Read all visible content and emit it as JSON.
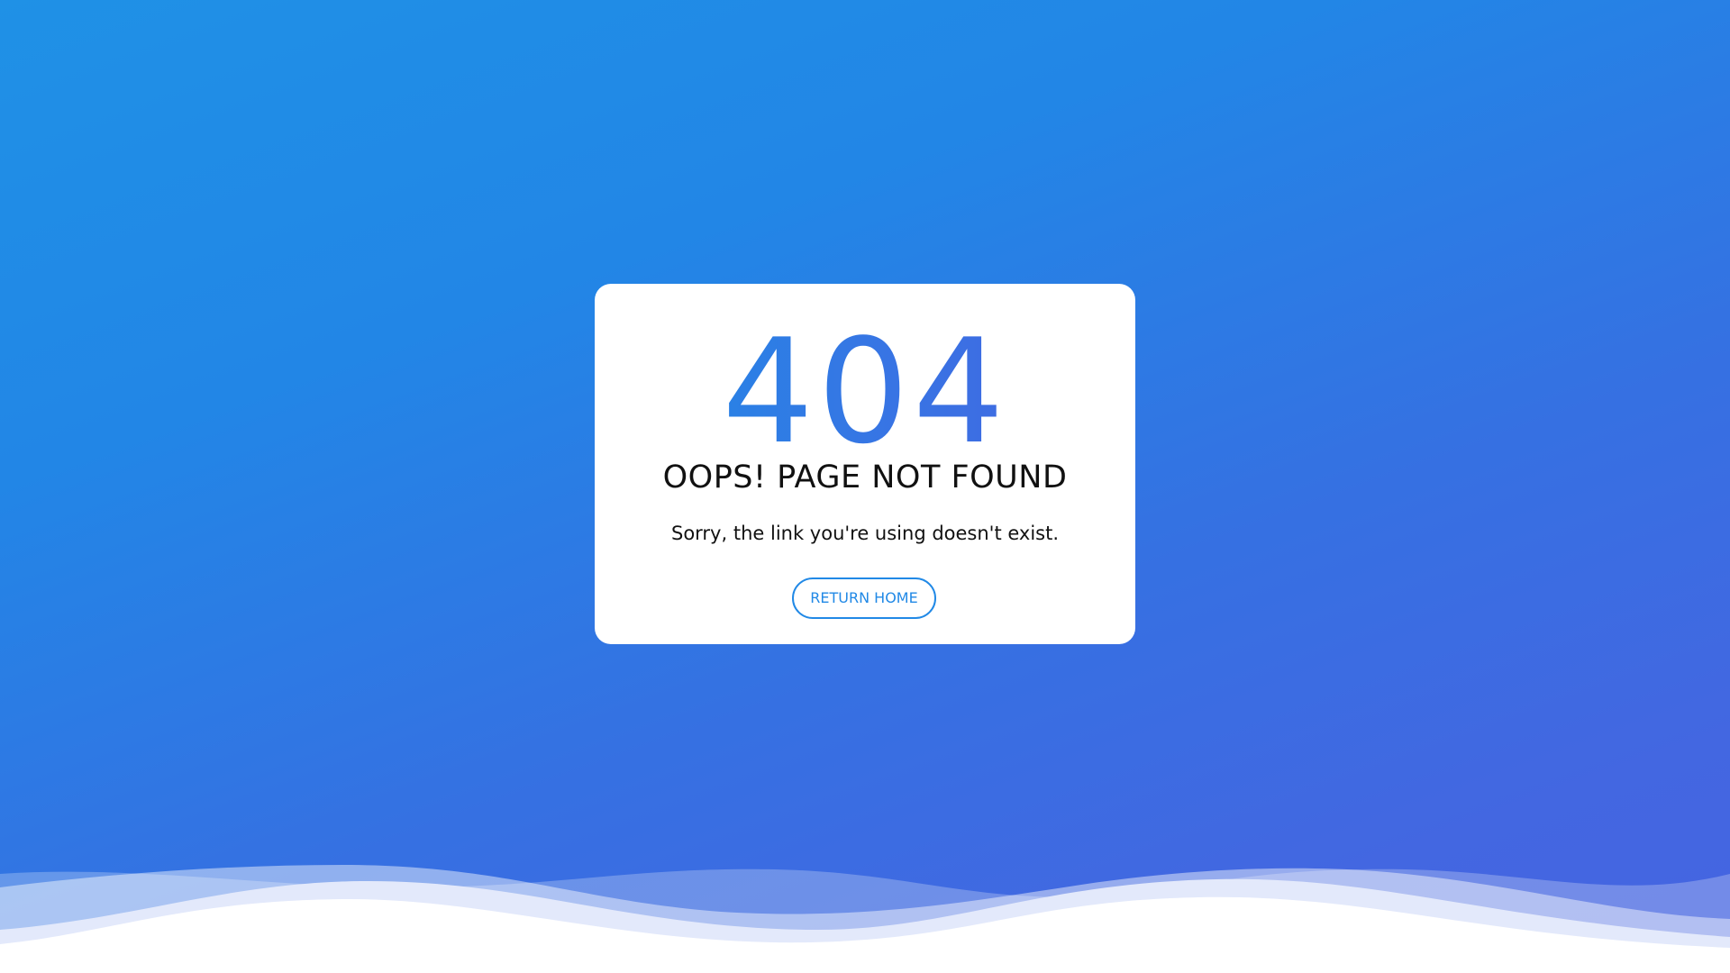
{
  "error": {
    "code": "404",
    "headline": "OOPS! PAGE NOT FOUND",
    "message": "Sorry, the link you're using doesn't exist.",
    "button_label": "RETURN HOME"
  },
  "colors": {
    "background_start": "#1f91e6",
    "background_end": "#4564e1",
    "accent": "#2189e6",
    "card": "#ffffff",
    "text": "#111111"
  }
}
